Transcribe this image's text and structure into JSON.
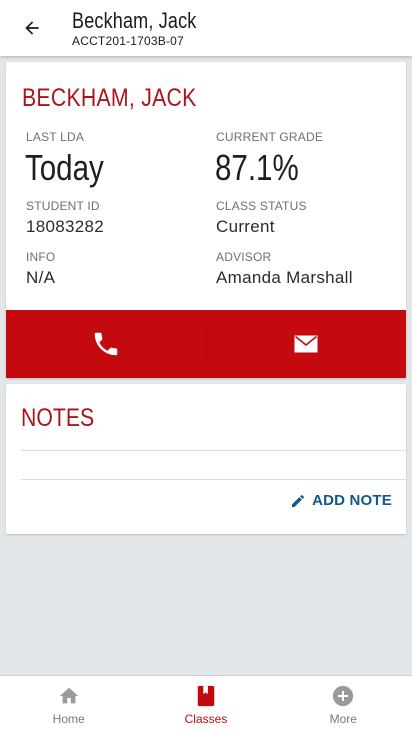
{
  "header": {
    "title": "Beckham, Jack",
    "subtitle": "ACCT201-1703B-07",
    "back_icon": "arrow-left-icon"
  },
  "student": {
    "name": "BECKHAM, JACK",
    "last_lda_label": "LAST LDA",
    "last_lda_value": "Today",
    "current_grade_label": "CURRENT GRADE",
    "current_grade_value": "87.1%",
    "student_id_label": "STUDENT ID",
    "student_id_value": "18083282",
    "class_status_label": "CLASS STATUS",
    "class_status_value": "Current",
    "info_label": "INFO",
    "info_value": "N/A",
    "advisor_label": "ADVISOR",
    "advisor_value": "Amanda Marshall"
  },
  "actions": {
    "phone_icon": "phone-icon",
    "email_icon": "email-icon"
  },
  "notes": {
    "title": "NOTES",
    "add_note_label": "ADD NOTE",
    "add_note_icon": "pencil-icon"
  },
  "bottom_nav": {
    "items": [
      {
        "label": "Home",
        "icon": "home-icon",
        "active": false
      },
      {
        "label": "Classes",
        "icon": "book-icon",
        "active": true
      },
      {
        "label": "More",
        "icon": "plus-circle-icon",
        "active": false
      }
    ]
  },
  "colors": {
    "brand_red": "#c4090f",
    "title_red": "#a8161c",
    "link_blue": "#0f5a86",
    "background": "#e4e7e9"
  }
}
